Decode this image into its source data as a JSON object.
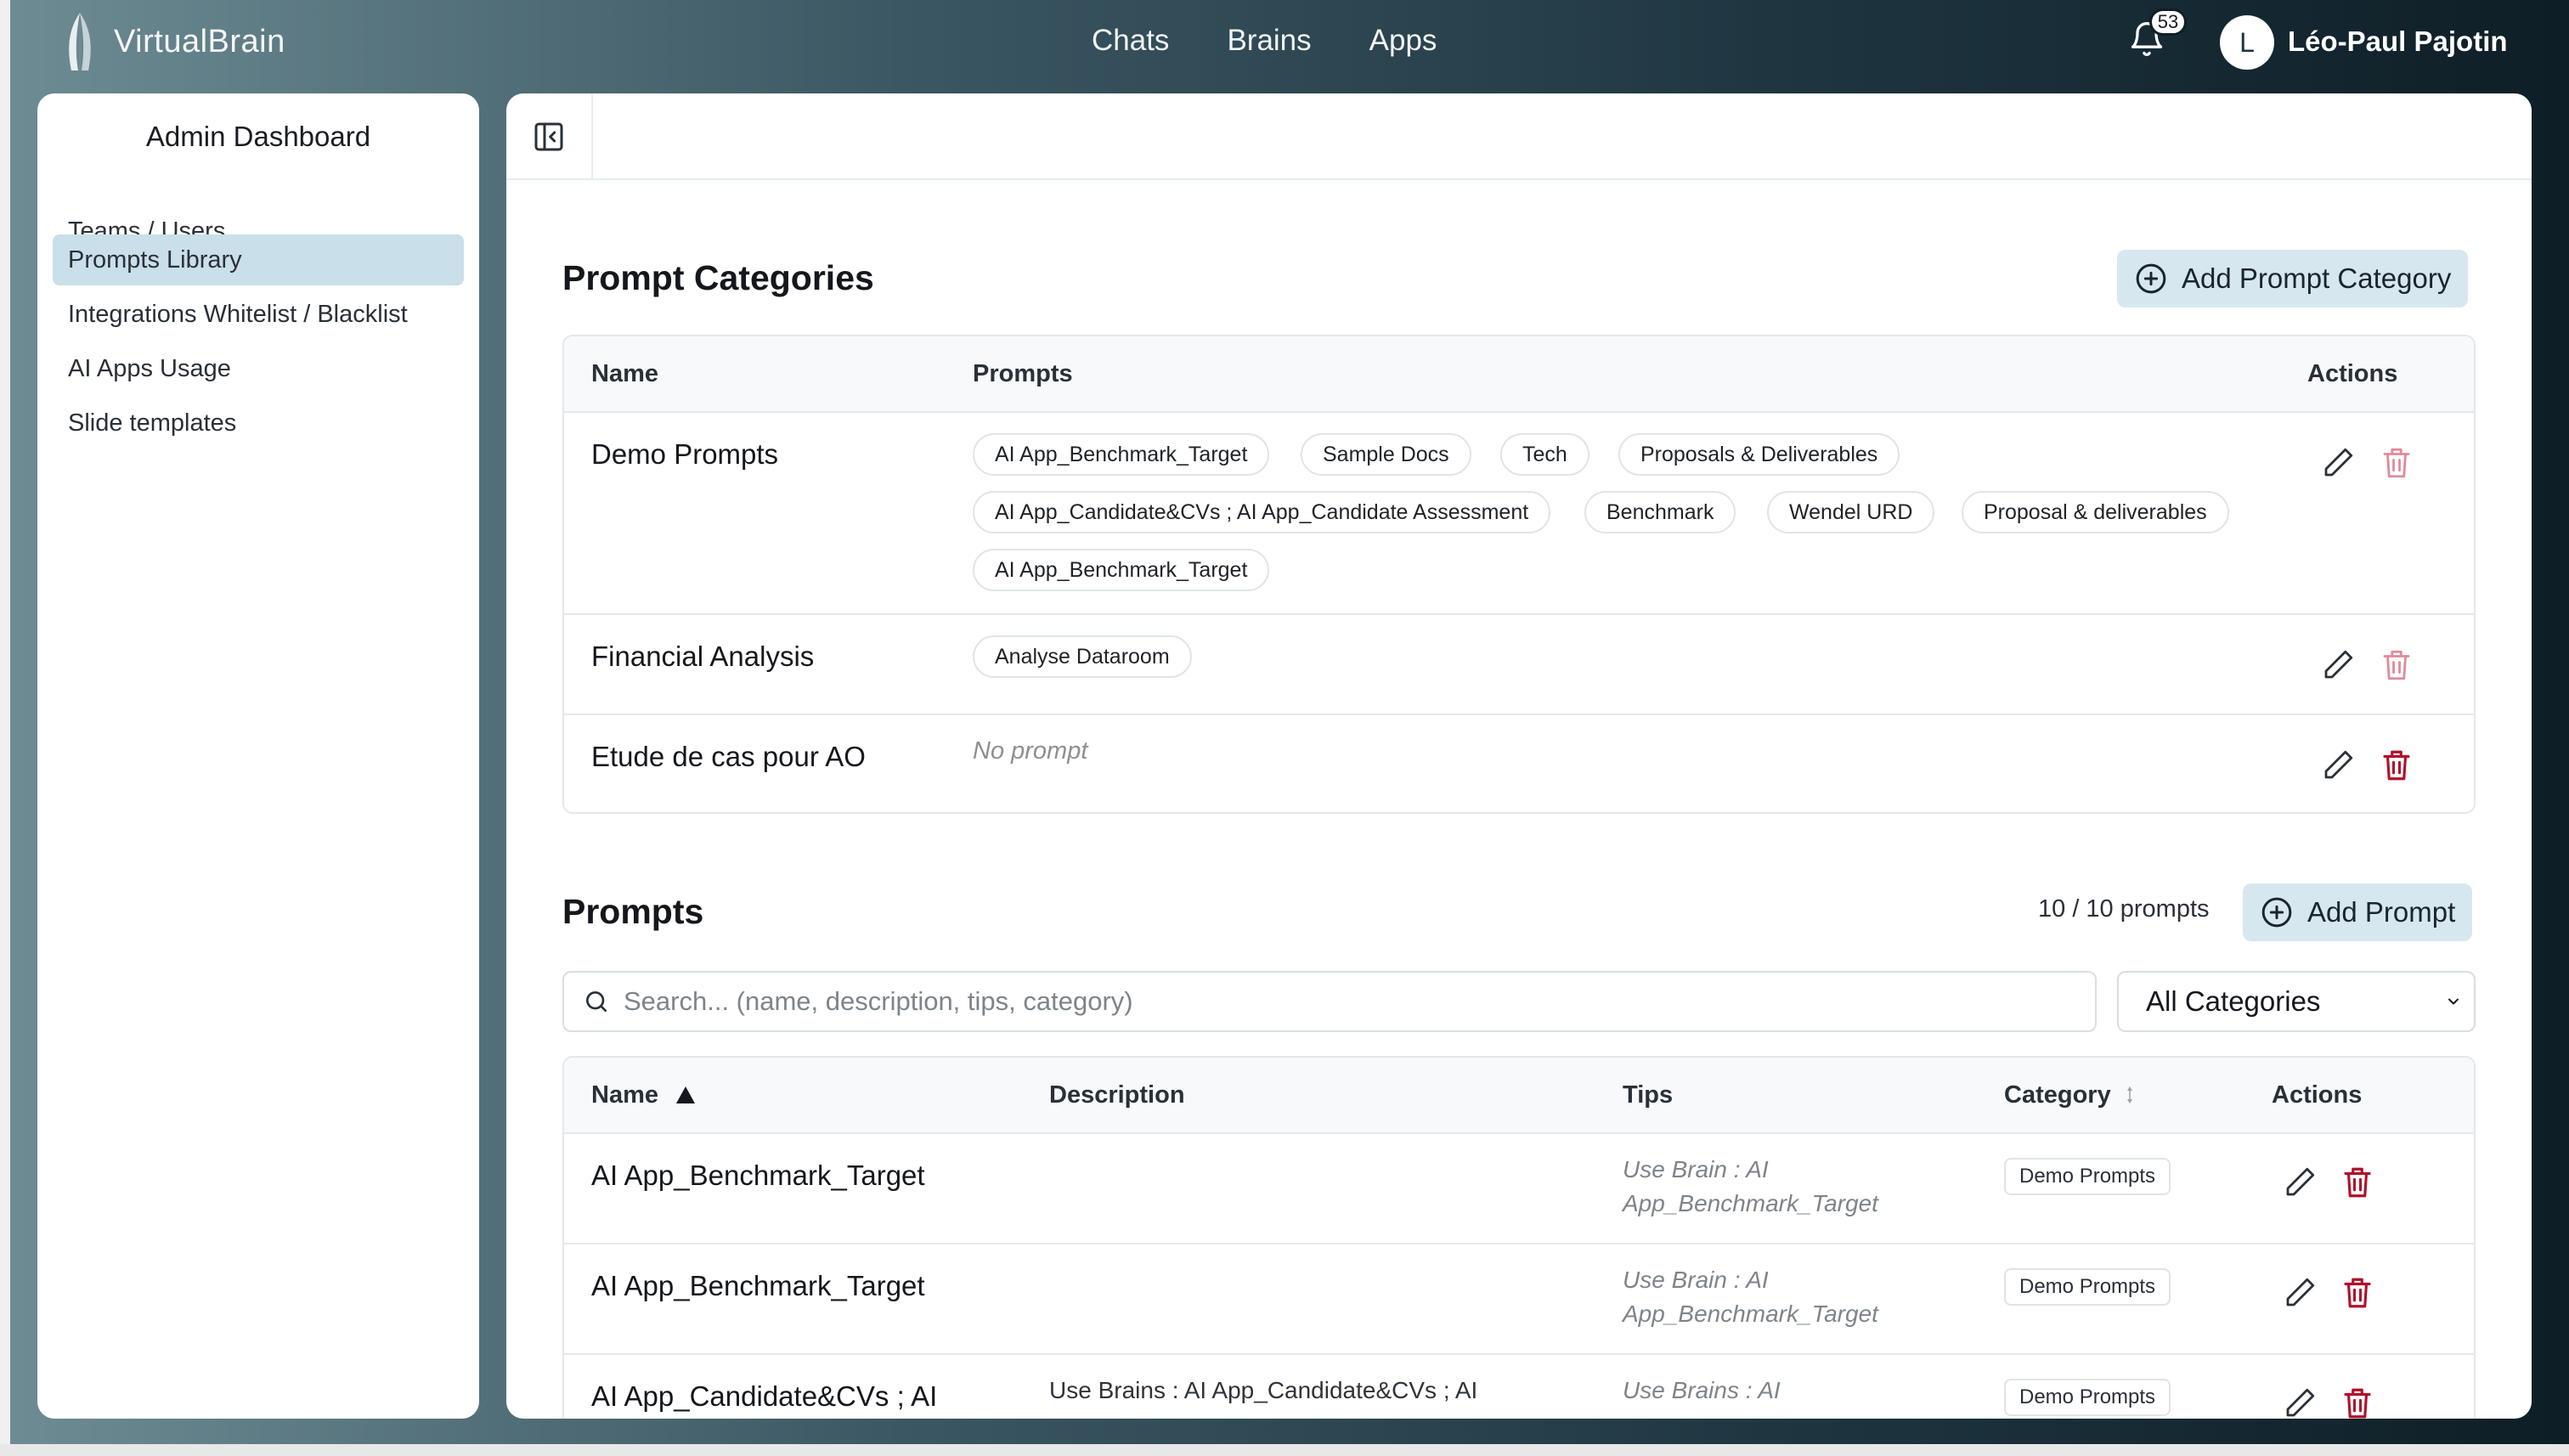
{
  "app": {
    "logo_text": "VirtualBrain"
  },
  "nav": [
    "Chats",
    "Brains",
    "Apps"
  ],
  "notifications": {
    "count": "53"
  },
  "user": {
    "initial": "L",
    "name": "Léo-Paul Pajotin"
  },
  "sidebar": {
    "title": "Admin Dashboard",
    "items": [
      {
        "label": "Teams / Users",
        "active": false
      },
      {
        "label": "Prompts Library",
        "active": true
      },
      {
        "label": "Integrations Whitelist / Blacklist",
        "active": false
      },
      {
        "label": "AI Apps Usage",
        "active": false
      },
      {
        "label": "Slide templates",
        "active": false
      }
    ]
  },
  "categories": {
    "title": "Prompt Categories",
    "add_label": "Add Prompt Category",
    "columns": {
      "name": "Name",
      "prompts": "Prompts",
      "actions": "Actions"
    },
    "rows": [
      {
        "name": "Demo Prompts",
        "prompts": [
          "AI App_Benchmark_Target",
          "Sample Docs",
          "Tech",
          "Proposals & Deliverables",
          "AI App_Candidate&CVs ; AI App_Candidate Assessment",
          "Benchmark",
          "Wendel URD",
          "Proposal & deliverables",
          "AI App_Benchmark_Target"
        ]
      },
      {
        "name": "Financial Analysis",
        "prompts": [
          "Analyse Dataroom"
        ]
      },
      {
        "name": "Etude de cas pour AO",
        "prompts": [],
        "empty_label": "No prompt"
      }
    ]
  },
  "prompts": {
    "title": "Prompts",
    "count_label": "10 / 10 prompts",
    "add_label": "Add Prompt",
    "search_placeholder": "Search... (name, description, tips, category)",
    "filter_value": "All Categories",
    "columns": {
      "name": "Name",
      "description": "Description",
      "tips": "Tips",
      "category": "Category",
      "actions": "Actions"
    },
    "rows": [
      {
        "name": "AI App_Benchmark_Target",
        "description": "",
        "tips_line1": "Use Brain : AI",
        "tips_line2": "App_Benchmark_Target",
        "category": "Demo Prompts"
      },
      {
        "name": "AI App_Benchmark_Target",
        "description": "",
        "tips_line1": "Use Brain : AI",
        "tips_line2": "App_Benchmark_Target",
        "category": "Demo Prompts"
      },
      {
        "name": "AI App_Candidate&CVs ; AI",
        "description": "Use Brains : AI App_Candidate&CVs ; AI",
        "tips_line1": "Use Brains : AI",
        "tips_line2": "",
        "category": "Demo Prompts"
      }
    ]
  },
  "colors": {
    "accent_bg": "#d7e7ef",
    "active_sidebar": "#c9dfe9",
    "danger": "#b0102a",
    "danger_muted": "#e08a99"
  }
}
